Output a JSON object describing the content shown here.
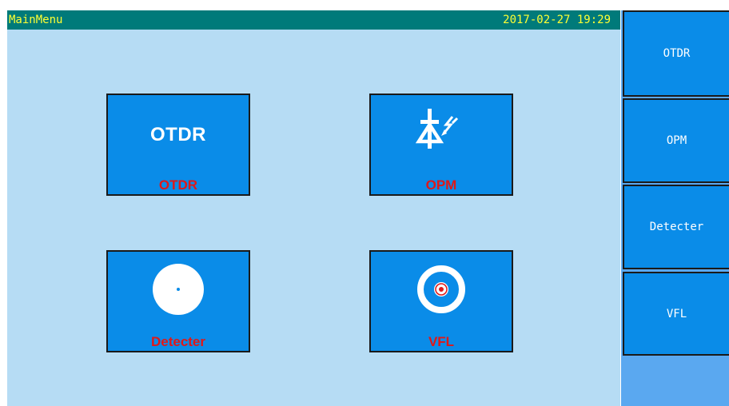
{
  "titlebar": {
    "title": "MainMenu",
    "datetime": "2017-02-27 19:29"
  },
  "tiles": [
    {
      "label": "OTDR",
      "glyph_text": "OTDR",
      "icon": "otdr-text-icon"
    },
    {
      "label": "OPM",
      "icon": "photodiode-icon"
    },
    {
      "label": "Detecter",
      "icon": "fiber-end-icon"
    },
    {
      "label": "VFL",
      "icon": "laser-target-icon"
    }
  ],
  "softkeys": [
    {
      "label": "OTDR"
    },
    {
      "label": "OPM"
    },
    {
      "label": "Detecter"
    },
    {
      "label": "VFL"
    }
  ],
  "colors": {
    "background": "#b6dcf4",
    "titlebar": "#007a7a",
    "titlebar_text": "#ffff33",
    "tile": "#0a8ce8",
    "tile_label": "#e01818",
    "softkey_panel": "#5aa8f0"
  }
}
